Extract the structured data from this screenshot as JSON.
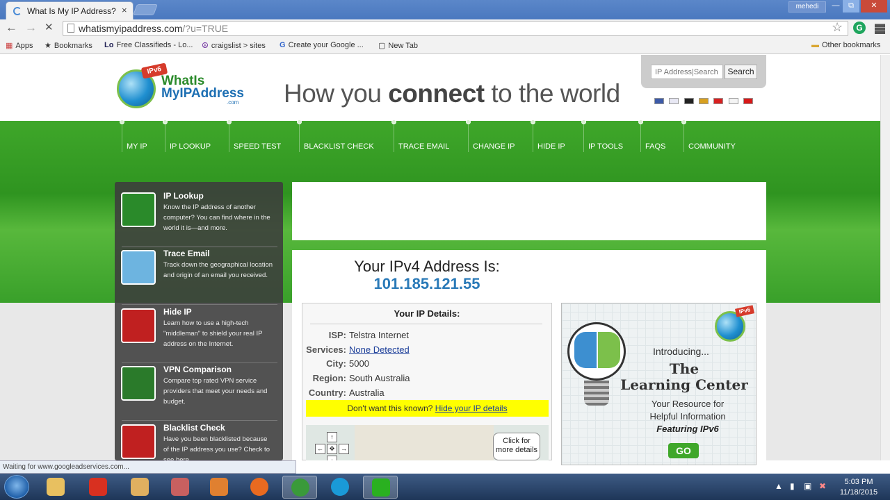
{
  "browser": {
    "tab_title": "What Is My IP Address? IP",
    "tab_close": "×",
    "user": "mehedi",
    "win_min": "—",
    "win_max": "⧉",
    "win_close": "✕",
    "url_main": "whatismyipaddress.com",
    "url_query": "/?u=TRUE",
    "back": "←",
    "forward": "→",
    "stop": "✕",
    "extension_letter": "G",
    "bookmarks": [
      {
        "icon": "▦",
        "label": "Apps"
      },
      {
        "icon": "★",
        "label": "Bookmarks"
      },
      {
        "icon": "Lo",
        "label": "Free Classifieds - Lo..."
      },
      {
        "icon": "☮",
        "label": "craigslist > sites"
      },
      {
        "icon": "G",
        "label": "Create your Google ..."
      },
      {
        "icon": "▢",
        "label": "New Tab"
      }
    ],
    "other_bookmarks": "Other bookmarks",
    "status": "Waiting for www.googleadservices.com..."
  },
  "header": {
    "logo_badge": "IPv6",
    "logo_line1": "WhatIs",
    "logo_line2": "MyIPAddress",
    "logo_com": ".com",
    "tagline_pre": "How you ",
    "tagline_bold": "connect",
    "tagline_post": " to the world",
    "search_placeholder": "IP Address|Search",
    "search_button": "Search",
    "flags": [
      "#3c5aa8",
      "#e8e8f4",
      "#222222",
      "#d8a020",
      "#d82020",
      "#f4f4f4",
      "#d81818"
    ]
  },
  "nav": [
    "MY IP",
    "IP LOOKUP",
    "SPEED TEST",
    "BLACKLIST CHECK",
    "TRACE EMAIL",
    "CHANGE IP",
    "HIDE IP",
    "IP TOOLS",
    "FAQS",
    "COMMUNITY"
  ],
  "sidebar": [
    {
      "title": "IP Lookup",
      "desc": "Know the IP address of another computer? You can find where in the world it is—and more.",
      "icon": "magnifier-icon",
      "color": "#2a8a2a"
    },
    {
      "title": "Trace Email",
      "desc": "Track down the geographical location and origin of an email you received.",
      "icon": "map-pin-icon",
      "color": "#6db4e0"
    },
    {
      "title": "Hide IP",
      "desc": "Learn how to use a high-tech \"middleman\" to shield your real IP address on the Internet.",
      "icon": "disguise-icon",
      "color": "#c02020"
    },
    {
      "title": "VPN Comparison",
      "desc": "Compare top rated VPN service providers that meet your needs and budget.",
      "icon": "lock-icon",
      "color": "#2a7a2a"
    },
    {
      "title": "Blacklist Check",
      "desc": "Have you been blacklisted because of the IP address you use? Check to see here.",
      "icon": "block-icon",
      "color": "#c02020"
    }
  ],
  "ip": {
    "label": "Your IPv4 Address Is:",
    "address": "101.185.121.55",
    "details_title": "Your IP Details:",
    "details": [
      {
        "key": "ISP:",
        "value": "Telstra Internet",
        "link": false
      },
      {
        "key": "Services:",
        "value": "None Detected",
        "link": true
      },
      {
        "key": "City:",
        "value": "5000",
        "link": false
      },
      {
        "key": "Region:",
        "value": "South Australia",
        "link": false
      },
      {
        "key": "Country:",
        "value": "Australia",
        "link": false
      }
    ],
    "warn_text": "Don't want this known?",
    "warn_link": "Hide your IP details",
    "map_bubble_1": "Click for",
    "map_bubble_2": "more details"
  },
  "ad": {
    "badge": "IPv6",
    "intro": "Introducing...",
    "title1": "The",
    "title2": "Learning Center",
    "line1": "Your Resource for",
    "line2": "Helpful Information",
    "line3": "Featuring IPv6",
    "go": "GO"
  },
  "taskbar": {
    "time": "5:03 PM",
    "date": "11/18/2015",
    "apps": [
      {
        "name": "explorer",
        "color": "#e8c060"
      },
      {
        "name": "ccleaner",
        "color": "#d83020"
      },
      {
        "name": "paint",
        "color": "#e0b060"
      },
      {
        "name": "snipping",
        "color": "#c86060"
      },
      {
        "name": "media",
        "color": "#e08030"
      },
      {
        "name": "firefox",
        "color": "#e86a20"
      },
      {
        "name": "chrome",
        "color": "#3a9a3a"
      },
      {
        "name": "skype",
        "color": "#1a9ad8"
      },
      {
        "name": "checkmark",
        "color": "#2ab020"
      }
    ]
  }
}
